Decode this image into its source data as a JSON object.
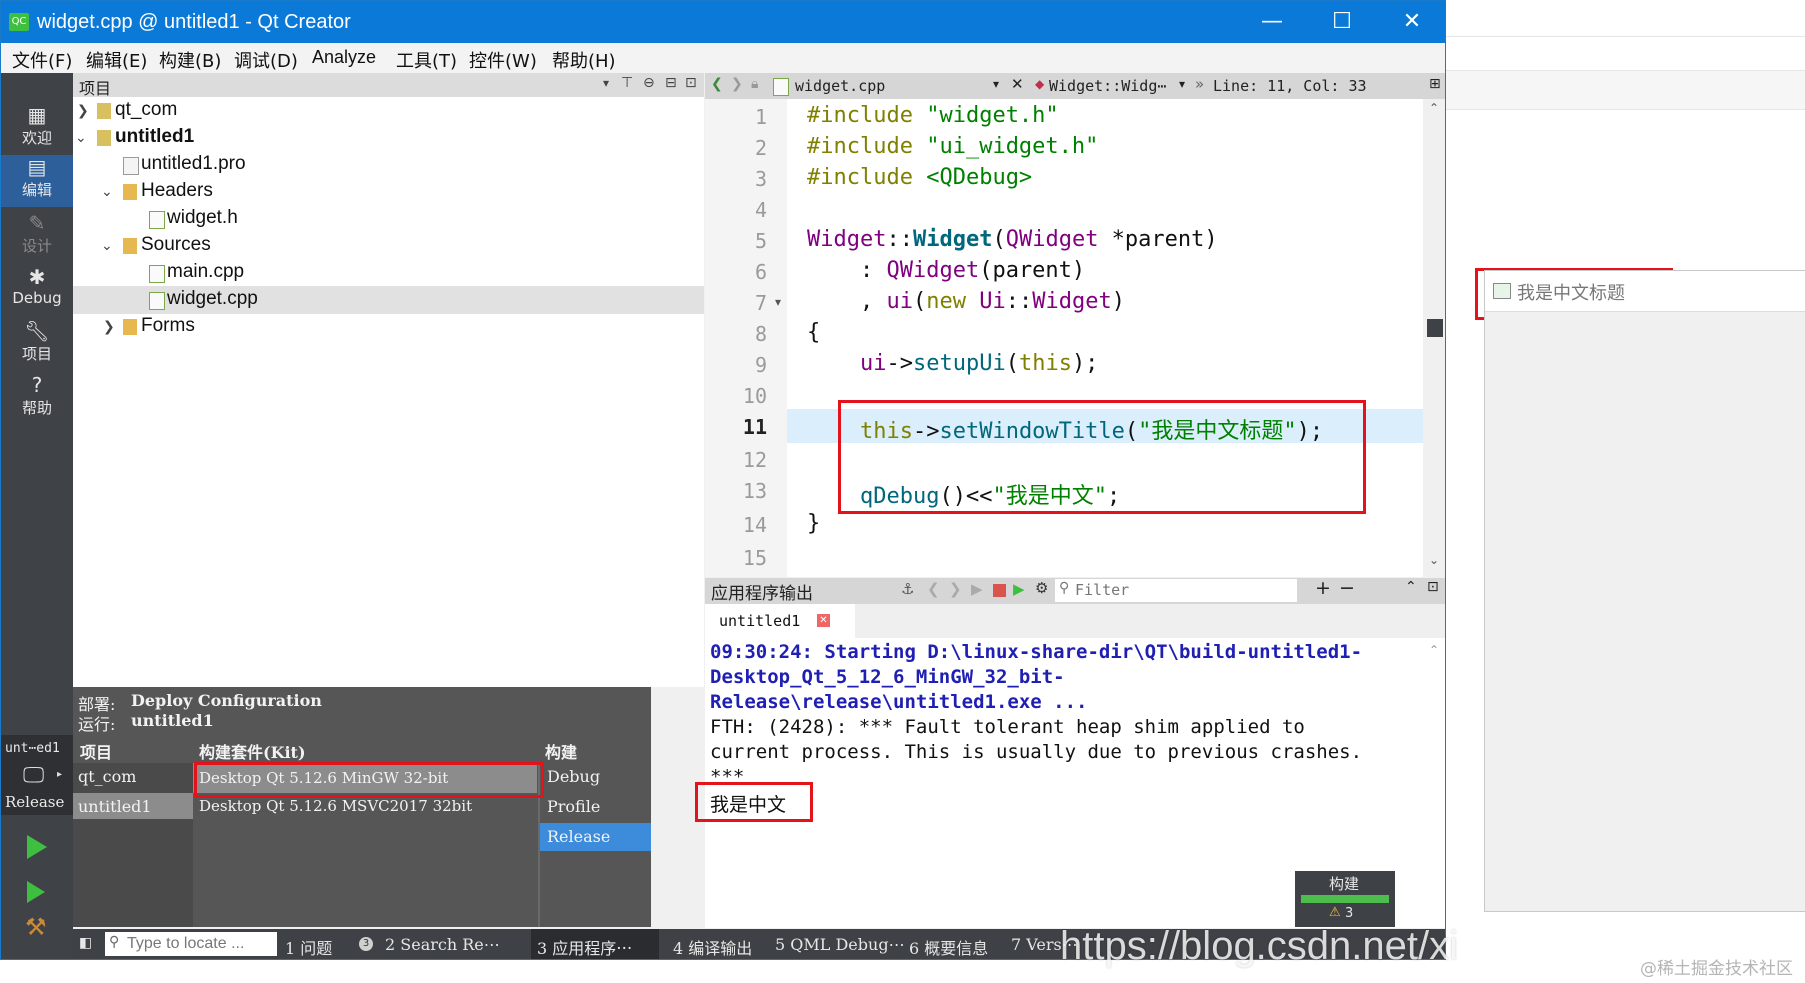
{
  "window": {
    "title": "widget.cpp @ untitled1 - Qt Creator",
    "app_icon": "QC",
    "controls": {
      "minimize": "—",
      "maximize": "☐",
      "close": "✕"
    }
  },
  "menu": [
    "文件(F)",
    "编辑(E)",
    "构建(B)",
    "调试(D)",
    "Analyze",
    "工具(T)",
    "控件(W)",
    "帮助(H)"
  ],
  "modes": [
    {
      "label": "欢迎",
      "icon": "grid-icon"
    },
    {
      "label": "编辑",
      "icon": "edit-doc-icon"
    },
    {
      "label": "设计",
      "icon": "pencil-icon"
    },
    {
      "label": "Debug",
      "icon": "bug-icon"
    },
    {
      "label": "项目",
      "icon": "wrench-icon"
    },
    {
      "label": "帮助",
      "icon": "help-icon"
    }
  ],
  "kit_selector": {
    "project": "unt⋯ed1",
    "config": "Release"
  },
  "project_panel": {
    "title": "项目",
    "tree": [
      {
        "label": "qt_com",
        "level": 0,
        "expanded": false,
        "bold": false
      },
      {
        "label": "untitled1",
        "level": 0,
        "expanded": true,
        "bold": true
      },
      {
        "label": "untitled1.pro",
        "level": 1
      },
      {
        "label": "Headers",
        "level": 1,
        "expanded": true
      },
      {
        "label": "widget.h",
        "level": 2
      },
      {
        "label": "Sources",
        "level": 1,
        "expanded": true
      },
      {
        "label": "main.cpp",
        "level": 2
      },
      {
        "label": "widget.cpp",
        "level": 2,
        "selected": true
      },
      {
        "label": "Forms",
        "level": 1,
        "expanded": false
      }
    ]
  },
  "editor": {
    "filename": "widget.cpp",
    "symbol": "Widget::Widg⋯",
    "position": "Line: 11,  Col: 33",
    "current_line": 11,
    "line_numbers": [
      "1",
      "2",
      "3",
      "4",
      "5",
      "6",
      "7",
      "8",
      "9",
      "10",
      "11",
      "12",
      "13",
      "14",
      "15"
    ],
    "code": {
      "l1a": "#include ",
      "l1b": "\"widget.h\"",
      "l2a": "#include ",
      "l2b": "\"ui_widget.h\"",
      "l3a": "#include ",
      "l3b": "<QDebug>",
      "l5a": "Widget",
      "l5b": "::",
      "l5c": "Widget",
      "l5d": "(",
      "l5e": "QWidget",
      "l5f": " *parent)",
      "l6a": "    : ",
      "l6b": "QWidget",
      "l6c": "(parent)",
      "l7a": "    , ",
      "l7b": "ui",
      "l7c": "(",
      "l7d": "new",
      "l7e": " ",
      "l7f": "Ui",
      "l7g": "::",
      "l7h": "Widget",
      "l7i": ")",
      "l8": "{",
      "l9a": "    ",
      "l9b": "ui",
      "l9c": "->",
      "l9d": "setupUi",
      "l9e": "(",
      "l9f": "this",
      "l9g": ");",
      "l11a": "    ",
      "l11b": "this",
      "l11c": "->",
      "l11d": "setWindowTitle",
      "l11e": "(",
      "l11f": "\"我是中文标题\"",
      "l11g": ");",
      "l13a": "    ",
      "l13b": "qDebug",
      "l13c": "()<<",
      "l13d": "\"我是中文\"",
      "l13e": ";",
      "l14": "}"
    }
  },
  "output": {
    "title": "应用程序输出",
    "filter_placeholder": "Filter",
    "tab": "untitled1",
    "lines": {
      "start1": "09:30:24: Starting D:\\linux-share-dir\\QT\\build-untitled1-",
      "start2": "Desktop_Qt_5_12_6_MinGW_32_bit-",
      "start3": "Release\\release\\untitled1.exe ...",
      "fth1": "FTH: (2428): *** Fault tolerant heap shim applied to",
      "fth2": "current process. This is usually due to previous crashes.",
      "fth3": "***",
      "debug": "我是中文"
    }
  },
  "kit_popup": {
    "deploy_label": "部署:",
    "deploy_value": "Deploy Configuration",
    "run_label": "运行:",
    "run_value": "untitled1",
    "col_project": "项目",
    "col_kit": "构建套件(Kit)",
    "col_build": "构建",
    "projects": [
      "qt_com",
      "untitled1"
    ],
    "kits": [
      "Desktop Qt 5.12.6 MinGW 32-bit",
      "Desktop Qt 5.12.6 MSVC2017 32bit"
    ],
    "builds": [
      "Debug",
      "Profile",
      "Release"
    ]
  },
  "build_badge": {
    "label": "构建",
    "warnings": "3"
  },
  "statusbar": {
    "locate_placeholder": "Type to locate ...",
    "tabs": [
      "1 问题",
      "2 Search Re⋯",
      "3 应用程序⋯",
      "4 编译输出",
      "5 QML Debug⋯",
      "6 概要信息",
      "7 Vers⋯"
    ],
    "issues_count": "3"
  },
  "right_window": {
    "title": "我是中文标题"
  },
  "watermarks": {
    "url": "https://blog.csdn.net/xi",
    "credit": "@稀土掘金技术社区"
  },
  "colors": {
    "accent": "#0a79d8",
    "annotation": "#e3121b",
    "selection": "#3d8bdb"
  }
}
